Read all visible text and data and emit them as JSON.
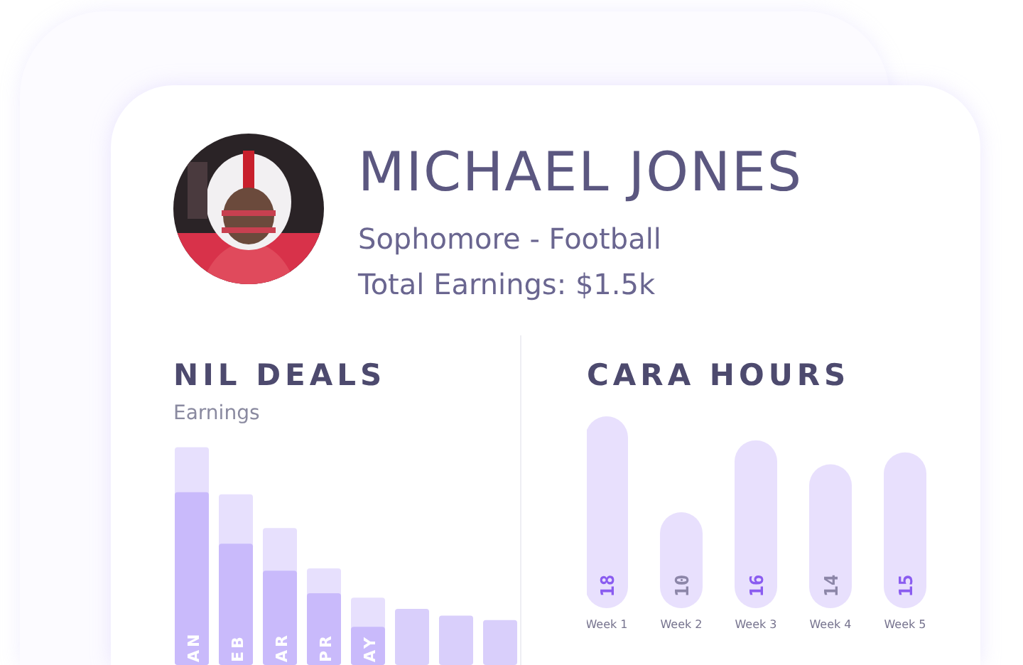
{
  "profile": {
    "name": "MICHAEL JONES",
    "subtitle": "Sophomore - Football",
    "earnings": "Total Earnings: $1.5k"
  },
  "nil_deals": {
    "title": "NIL DEALS",
    "label": "Earnings",
    "bars": [
      {
        "label": "AN",
        "segments": [
          {
            "kind": "paid",
            "level": 0.77
          },
          {
            "kind": "pending",
            "level": 0.97
          }
        ]
      },
      {
        "label": "EB",
        "segments": [
          {
            "kind": "paid",
            "level": 0.54
          },
          {
            "kind": "pending",
            "level": 0.76
          }
        ]
      },
      {
        "label": "AR",
        "segments": [
          {
            "kind": "paid",
            "level": 0.42
          },
          {
            "kind": "pending",
            "level": 0.61
          }
        ]
      },
      {
        "label": "PR",
        "segments": [
          {
            "kind": "paid",
            "level": 0.32
          },
          {
            "kind": "pending",
            "level": 0.43
          }
        ]
      },
      {
        "label": "AY",
        "segments": [
          {
            "kind": "paid",
            "level": 0.17
          },
          {
            "kind": "pending",
            "level": 0.3
          }
        ]
      },
      {
        "segments": [
          {
            "kind": "other",
            "level": 0.25
          }
        ]
      },
      {
        "segments": [
          {
            "kind": "other",
            "level": 0.22
          }
        ]
      },
      {
        "segments": [
          {
            "kind": "other",
            "level": 0.2
          }
        ]
      }
    ]
  },
  "cara_hours": {
    "title": "CARA HOURS",
    "chart_data": {
      "type": "bar",
      "categories": [
        "Week 1",
        "Week 2",
        "Week 3",
        "Week 4",
        "Week 5"
      ],
      "values": [
        18,
        10,
        16,
        14,
        15
      ],
      "ylim": [
        2,
        18
      ],
      "data_labels": true
    }
  }
}
